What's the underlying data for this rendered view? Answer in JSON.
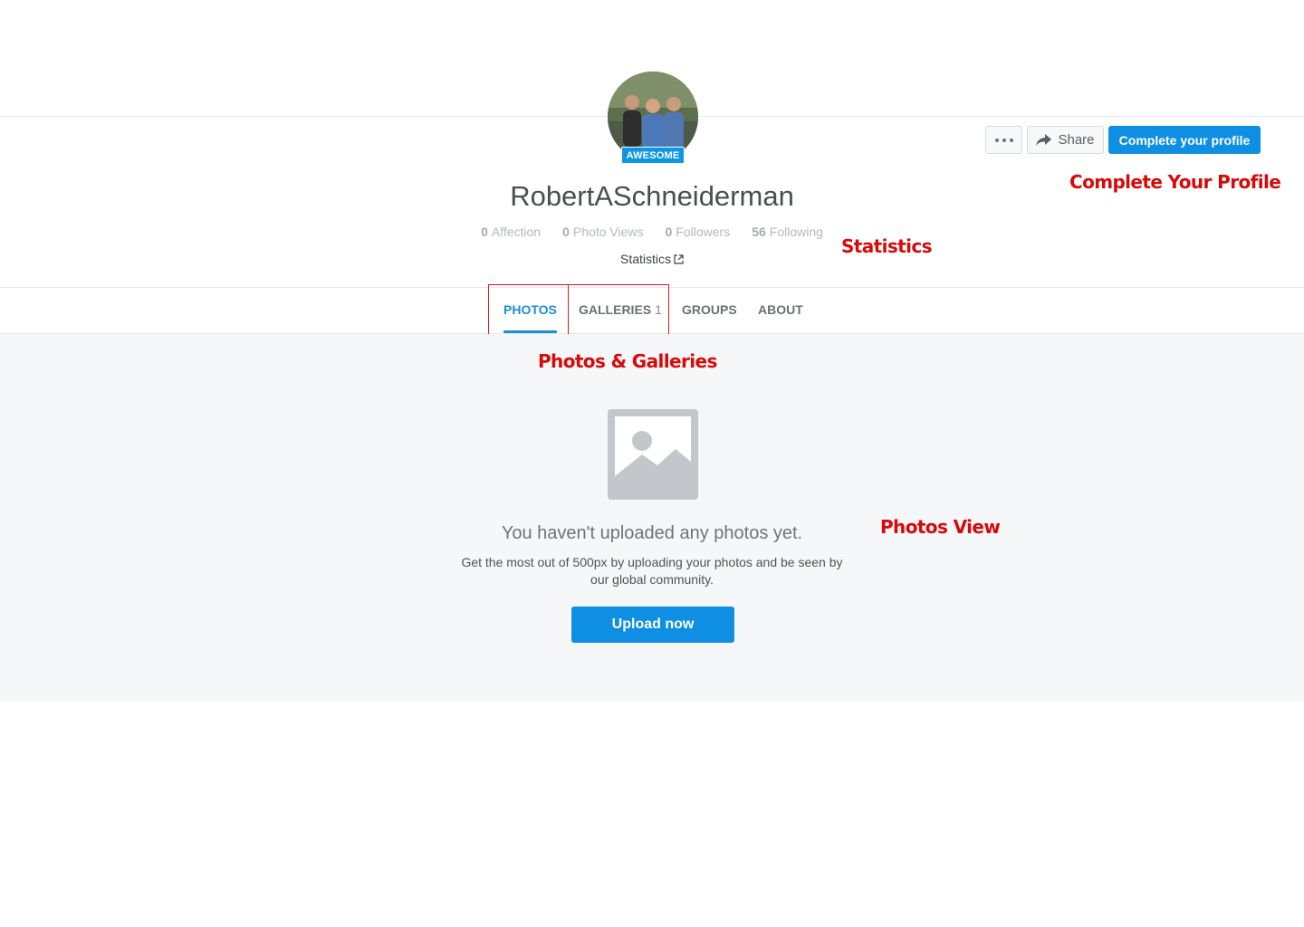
{
  "profile": {
    "badge": "AWESOME",
    "username": "RobertASchneiderman",
    "avatar_icon": "profile-photo-avatar"
  },
  "actions": {
    "more_icon": "ellipsis-icon",
    "share_label": "Share",
    "share_icon": "share-arrow-icon",
    "complete_label": "Complete your profile"
  },
  "stats": [
    {
      "value": "0",
      "label": "Affection"
    },
    {
      "value": "0",
      "label": "Photo Views"
    },
    {
      "value": "0",
      "label": "Followers"
    },
    {
      "value": "56",
      "label": "Following"
    }
  ],
  "statistics_link": "Statistics",
  "tabs": [
    {
      "label": "PHOTOS",
      "count": "",
      "active": true
    },
    {
      "label": "GALLERIES",
      "count": "1",
      "active": false
    },
    {
      "label": "GROUPS",
      "count": "",
      "active": false
    },
    {
      "label": "ABOUT",
      "count": "",
      "active": false
    }
  ],
  "empty_state": {
    "icon": "image-placeholder-icon",
    "title": "You haven't uploaded any photos yet.",
    "description": "Get the most out of 500px by uploading your photos and be seen by our global community.",
    "upload_label": "Upload now"
  },
  "annotations": {
    "complete_profile": "Complete Your Profile",
    "statistics": "Statistics",
    "photos_galleries": "Photos & Galleries",
    "photos_view": "Photos View"
  },
  "colors": {
    "accent": "#0e8fe3",
    "annotation": "#d60a0a",
    "panel_bg": "#f6f7f8"
  }
}
